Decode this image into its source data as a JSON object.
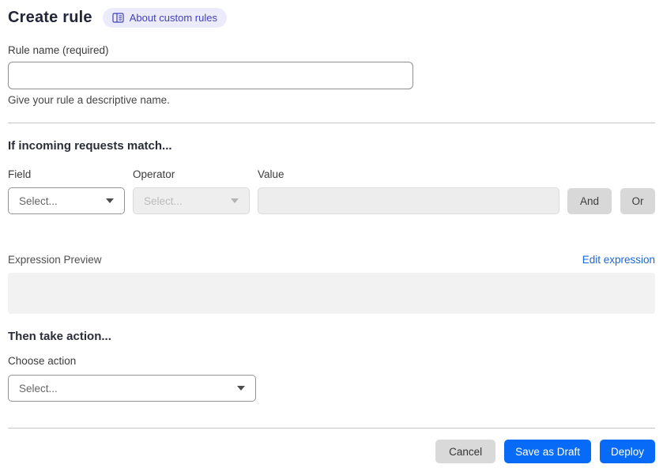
{
  "page": {
    "title": "Create rule",
    "about_badge_label": "About custom rules"
  },
  "rule_name": {
    "label": "Rule name (required)",
    "value": "",
    "helper": "Give your rule a descriptive name."
  },
  "match_section": {
    "heading": "If incoming requests match...",
    "field": {
      "label": "Field",
      "selected": "Select..."
    },
    "operator": {
      "label": "Operator",
      "selected": "Select..."
    },
    "value": {
      "label": "Value",
      "value": ""
    },
    "and_button": "And",
    "or_button": "Or"
  },
  "expression": {
    "preview_label": "Expression Preview",
    "edit_link": "Edit expression",
    "preview_value": ""
  },
  "action_section": {
    "heading": "Then take action...",
    "choose_label": "Choose action",
    "selected": "Select..."
  },
  "footer": {
    "cancel": "Cancel",
    "save_draft": "Save as Draft",
    "deploy": "Deploy"
  },
  "colors": {
    "primary_button_blue": "#086bf7",
    "link_blue": "#1a67d4",
    "badge_background": "#ecebfc",
    "badge_text": "#4141bd",
    "secondary_button_gray": "#d8d8d8",
    "disabled_field_gray": "#eeeeee",
    "preview_box_gray": "#f2f2f2"
  }
}
